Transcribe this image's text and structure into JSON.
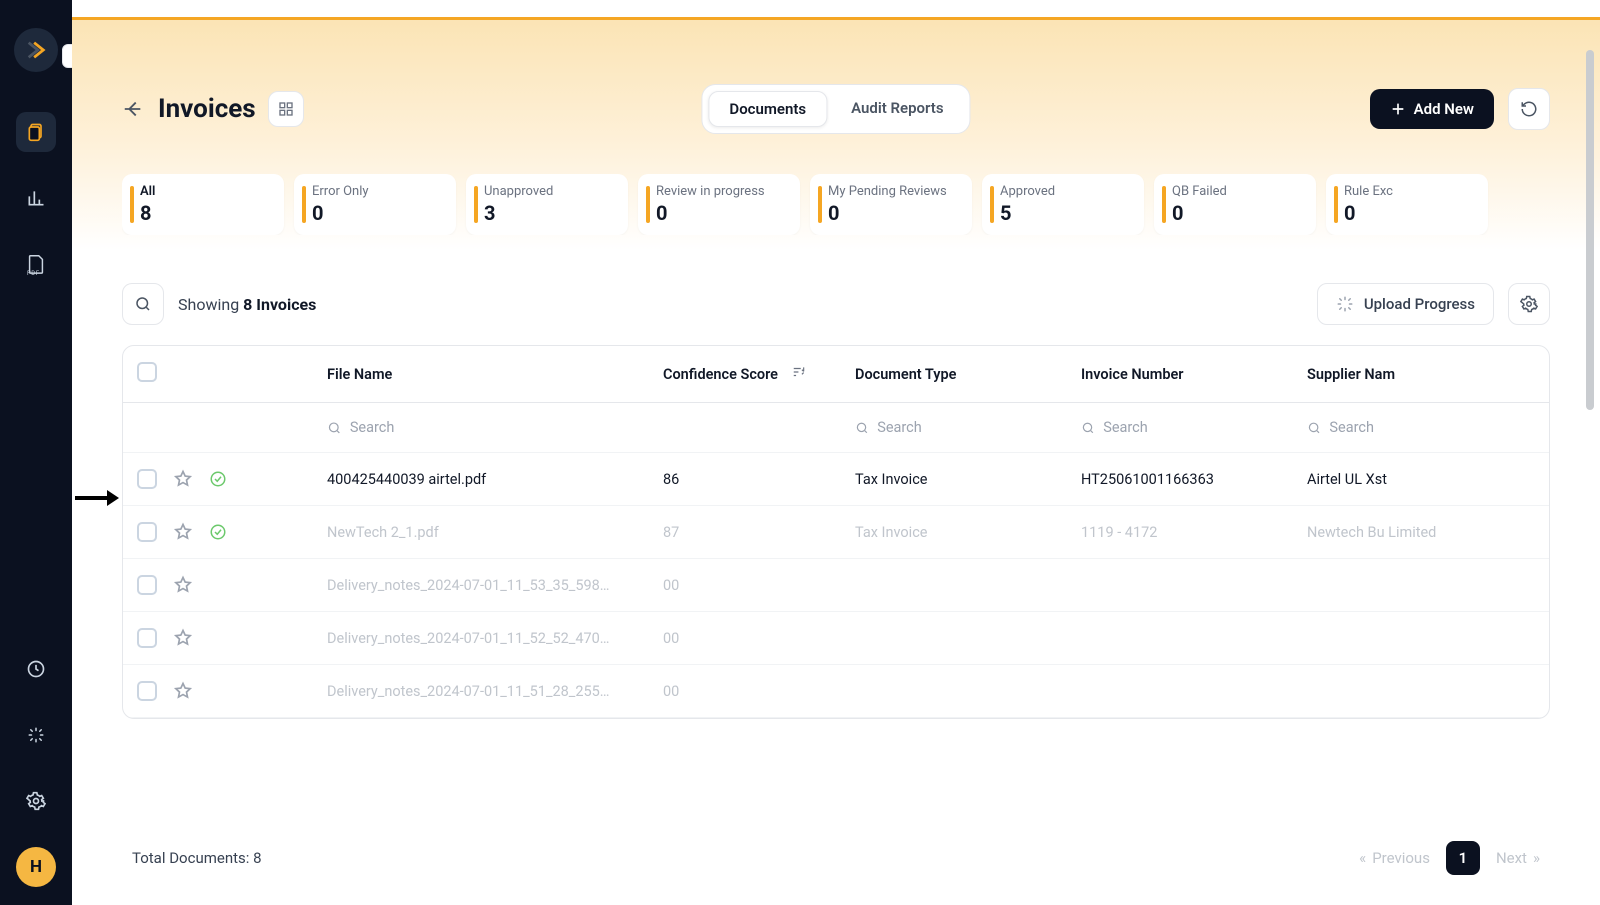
{
  "sidebar": {
    "avatar_letter": "H"
  },
  "header": {
    "title": "Invoices",
    "views": {
      "documents": "Documents",
      "audit": "Audit Reports"
    },
    "add_new": "Add New"
  },
  "status_cards": [
    {
      "label": "All",
      "count": "8"
    },
    {
      "label": "Error Only",
      "count": "0"
    },
    {
      "label": "Unapproved",
      "count": "3"
    },
    {
      "label": "Review in progress",
      "count": "0"
    },
    {
      "label": "My Pending Reviews",
      "count": "0"
    },
    {
      "label": "Approved",
      "count": "5"
    },
    {
      "label": "QB Failed",
      "count": "0"
    },
    {
      "label": "Rule Exc",
      "count": "0"
    }
  ],
  "toolbar": {
    "showing_prefix": "Showing ",
    "showing_bold": "8 Invoices",
    "upload_progress": "Upload Progress"
  },
  "columns": {
    "file_name": "File Name",
    "confidence": "Confidence Score",
    "doc_type": "Document Type",
    "invoice_no": "Invoice Number",
    "supplier": "Supplier Nam"
  },
  "search_placeholder": "Search",
  "rows": [
    {
      "file": "400425440039 airtel.pdf",
      "conf": "86",
      "doctype": "Tax Invoice",
      "invno": "HT25061001166363",
      "supplier": "Airtel UL Xst",
      "approved": true,
      "dim": false
    },
    {
      "file": "NewTech 2_1.pdf",
      "conf": "87",
      "doctype": "Tax Invoice",
      "invno": "1119 - 4172",
      "supplier": "Newtech Bu Limited",
      "approved": true,
      "dim": true
    },
    {
      "file": "Delivery_notes_2024-07-01_11_53_35_598…",
      "conf": "00",
      "doctype": "",
      "invno": "",
      "supplier": "",
      "approved": false,
      "dim": true
    },
    {
      "file": "Delivery_notes_2024-07-01_11_52_52_470…",
      "conf": "00",
      "doctype": "",
      "invno": "",
      "supplier": "",
      "approved": false,
      "dim": true
    },
    {
      "file": "Delivery_notes_2024-07-01_11_51_28_255…",
      "conf": "00",
      "doctype": "",
      "invno": "",
      "supplier": "",
      "approved": false,
      "dim": true
    }
  ],
  "footer": {
    "total_label": "Total Documents: 8",
    "prev": "Previous",
    "page": "1",
    "next": "Next"
  }
}
